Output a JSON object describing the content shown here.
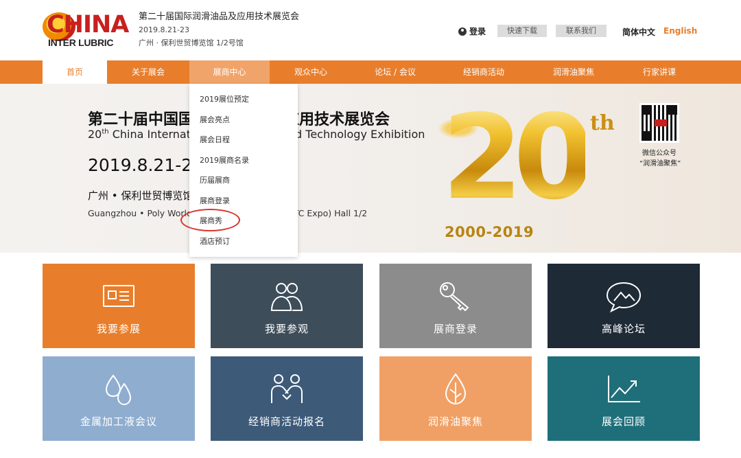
{
  "header": {
    "logo_word": "CHINA",
    "logo_sub": "INTER LUBRIC",
    "title": "第二十届国际润滑油品及应用技术展览会",
    "date": "2019.8.21-23",
    "venue": "广州 · 保利世贸博览馆 1/2号馆",
    "login_label": "登录",
    "download_label": "快速下载",
    "contact_label": "联系我们",
    "lang_cn": "简体中文",
    "lang_en": "English"
  },
  "nav": {
    "items": [
      {
        "label": "首页",
        "state": "active"
      },
      {
        "label": "关于展会",
        "state": "normal"
      },
      {
        "label": "展商中心",
        "state": "hover"
      },
      {
        "label": "观众中心",
        "state": "normal"
      },
      {
        "label": "论坛 / 会议",
        "state": "normal"
      },
      {
        "label": "经销商活动",
        "state": "normal"
      },
      {
        "label": "润滑油聚焦",
        "state": "normal"
      },
      {
        "label": "行家讲课",
        "state": "normal"
      }
    ]
  },
  "dropdown": {
    "items": [
      "2019展位预定",
      "展会亮点",
      "展会日程",
      "2019展商名录",
      "历届展商",
      "展商登录",
      "展商秀",
      "酒店预订"
    ],
    "highlighted": "展商秀"
  },
  "banner": {
    "title": "第二十届中国国际润滑油品及应用技术展览会",
    "subtitle_prefix": "20",
    "subtitle_sup": "th",
    "subtitle_rest": " China International Lubricants and Technology Exhibition",
    "date": "2019.8.21-23",
    "location_cn": "广州 • 保利世贸博览馆1/2号馆",
    "location_en": "Guangzhou • Poly World Trade Center Expo (PWTC Expo) Hall 1/2",
    "badge_number": "20",
    "badge_suffix": "th",
    "badge_years": "2000-2019",
    "qr_caption1": "微信公众号",
    "qr_caption2": "“润滑油聚焦”"
  },
  "tiles": [
    {
      "label": "我要参展",
      "icon": "id-card-icon",
      "color": "#e87e2c"
    },
    {
      "label": "我要参观",
      "icon": "people-icon",
      "color": "#3e4d5a"
    },
    {
      "label": "展商登录",
      "icon": "key-icon",
      "color": "#8c8c8c"
    },
    {
      "label": "高峰论坛",
      "icon": "chat-bubble-icon",
      "color": "#1e2a36"
    },
    {
      "label": "金属加工液会议",
      "icon": "droplets-icon",
      "color": "#8fadcf"
    },
    {
      "label": "经销商活动报名",
      "icon": "handshake-icon",
      "color": "#3d5a78"
    },
    {
      "label": "润滑油聚焦",
      "icon": "oil-drop-icon",
      "color": "#f0a065"
    },
    {
      "label": "展会回顾",
      "icon": "chart-trend-icon",
      "color": "#1f6f7a"
    }
  ]
}
